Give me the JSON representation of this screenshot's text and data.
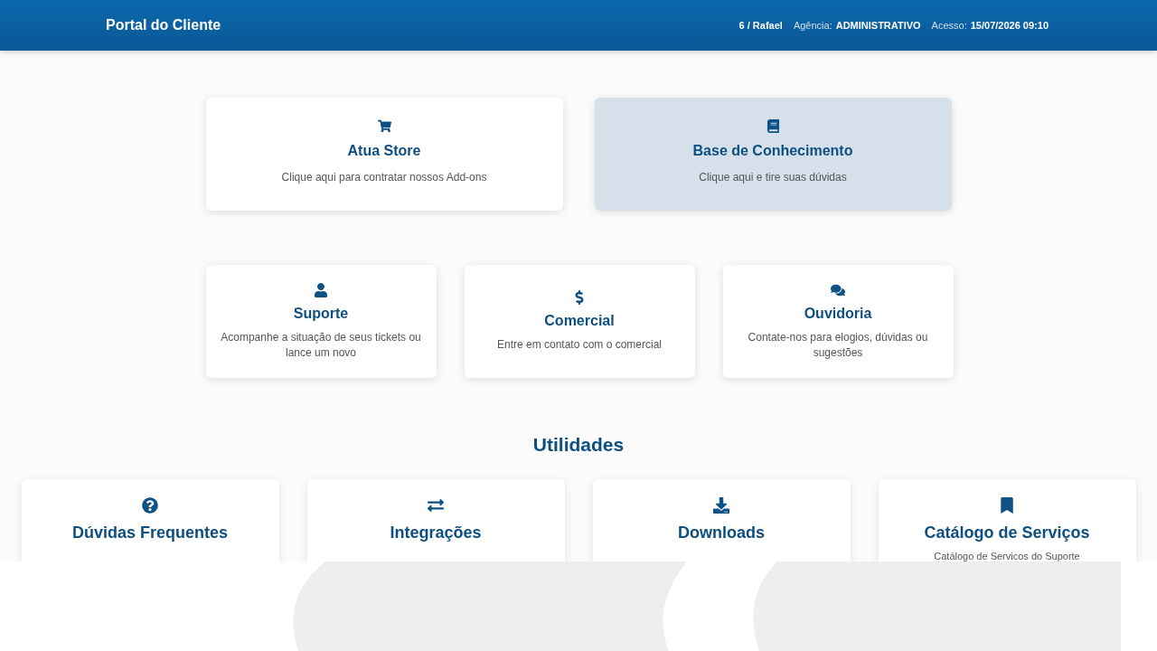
{
  "header": {
    "title": "Portal do Cliente",
    "user": "6 / Rafael",
    "agency_label": "Agência:",
    "agency": "ADMINISTRATIVO",
    "access_label": "Acesso:",
    "access": "15/07/2026 09:10"
  },
  "top_cards": [
    {
      "title": "Atua Store",
      "text": "Clique aqui para contratar nossos Add-ons",
      "highlighted": false
    },
    {
      "title": "Base de Conhecimento",
      "text": "Clique aqui e tire suas dúvidas",
      "highlighted": true
    }
  ],
  "middle_cards": [
    {
      "title": "Suporte",
      "text": "Acompanhe a situação de seus tickets ou lance um novo"
    },
    {
      "title": "Comercial",
      "text": "Entre em contato com o comercial"
    },
    {
      "title": "Ouvidoria",
      "text": "Contate-nos para elogios, dúvidas ou sugestões"
    }
  ],
  "utilities": {
    "heading": "Utilidades",
    "cards": [
      {
        "title": "Dúvidas Frequentes"
      },
      {
        "title": "Integrações"
      },
      {
        "title": "Downloads"
      },
      {
        "title": "Catálogo de Serviços",
        "text": "Catálogo de Servicos do Suporte"
      }
    ]
  }
}
